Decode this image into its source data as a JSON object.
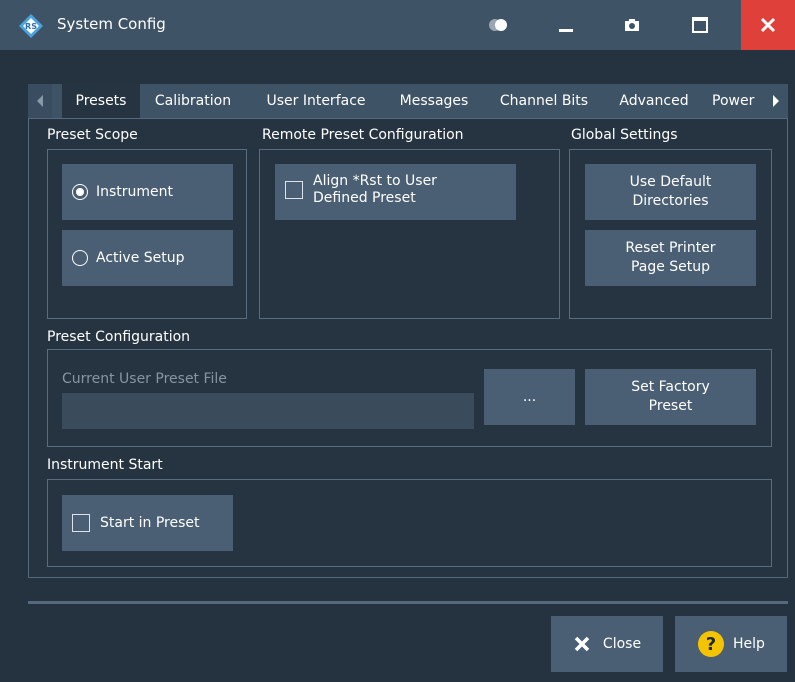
{
  "window": {
    "title": "System Config"
  },
  "tabs": [
    "Presets",
    "Calibration",
    "User Interface",
    "Messages",
    "Channel Bits",
    "Advanced",
    "Power"
  ],
  "preset_scope": {
    "label": "Preset Scope",
    "options": [
      "Instrument",
      "Active Setup"
    ],
    "selected": "Instrument"
  },
  "remote_preset": {
    "label": "Remote Preset Configuration",
    "align_line1": "Align *Rst to User",
    "align_line2": "Defined Preset"
  },
  "global_settings": {
    "label": "Global Settings",
    "use_default_line1": "Use Default",
    "use_default_line2": "Directories",
    "reset_printer_line1": "Reset Printer",
    "reset_printer_line2": "Page Setup"
  },
  "preset_config": {
    "label": "Preset Configuration",
    "file_label": "Current User Preset File",
    "file_value": "",
    "browse_label": "...",
    "factory_line1": "Set Factory",
    "factory_line2": "Preset"
  },
  "instrument_start": {
    "label": "Instrument Start",
    "start_in_preset": "Start in Preset"
  },
  "footer": {
    "close_label": "Close",
    "help_label": "Help"
  },
  "colors": {
    "accent_close": "#e0403a",
    "help_icon": "#f5c400"
  }
}
